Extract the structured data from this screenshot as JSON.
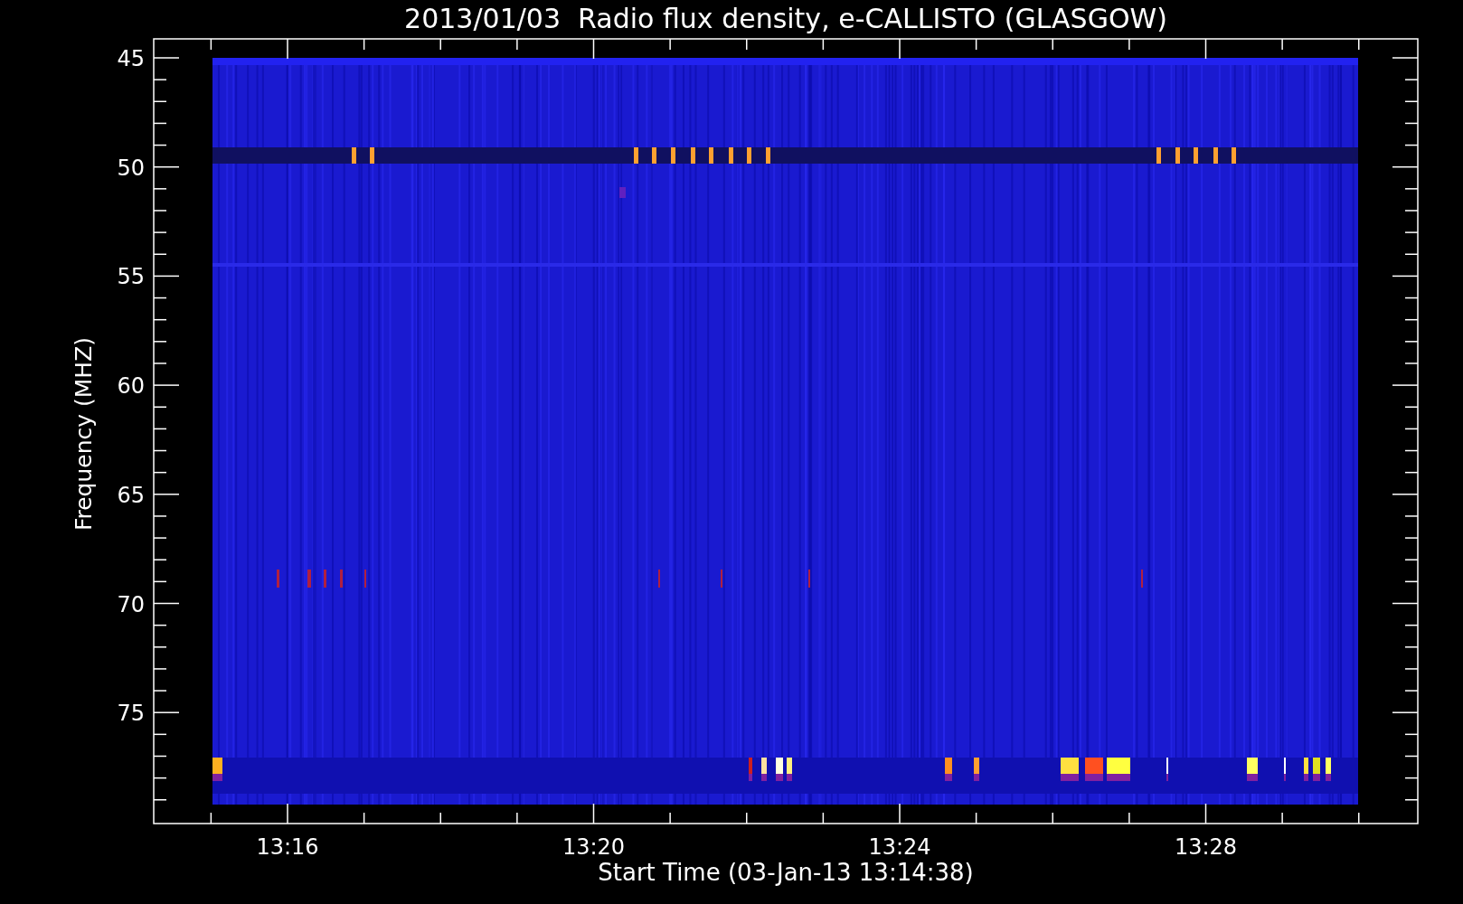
{
  "title": "2013/01/03  Radio flux density, e-CALLISTO (GLASGOW)",
  "ylabel": "Frequency (MHZ)",
  "xlabel": "Start Time (03-Jan-13 13:14:38)",
  "yticks": [
    "45",
    "50",
    "55",
    "60",
    "65",
    "70",
    "75"
  ],
  "xticks": [
    "13:16",
    "13:20",
    "13:24",
    "13:28"
  ]
}
